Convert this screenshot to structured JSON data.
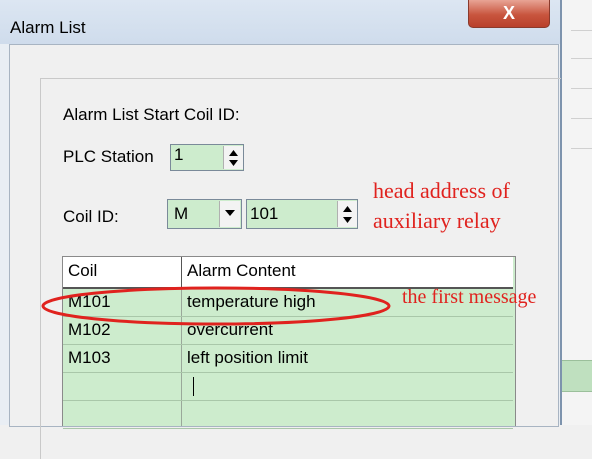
{
  "window": {
    "title": "Alarm List",
    "close_glyph": "X"
  },
  "form": {
    "section_label": "Alarm List Start Coil ID:",
    "plc_station_label": "PLC Station",
    "plc_station_value": "1",
    "coil_id_label": "Coil ID:",
    "coil_type_value": "M",
    "coil_number_value": "101"
  },
  "annotations": {
    "head_address_line1": "head address of",
    "head_address_line2": "auxiliary relay",
    "first_message": "the first message",
    "color": "#e0221e"
  },
  "table": {
    "headers": [
      "Coil",
      "Alarm Content"
    ],
    "rows": [
      {
        "coil": "M101",
        "content": "temperature high"
      },
      {
        "coil": "M102",
        "content": "overcurrent"
      },
      {
        "coil": "M103",
        "content": "left position limit"
      },
      {
        "coil": "",
        "content": ""
      },
      {
        "coil": "",
        "content": ""
      }
    ]
  },
  "colors": {
    "field_green": "#cdeccd",
    "titlebar": "#dce6f2",
    "close_red": "#c8553e"
  }
}
